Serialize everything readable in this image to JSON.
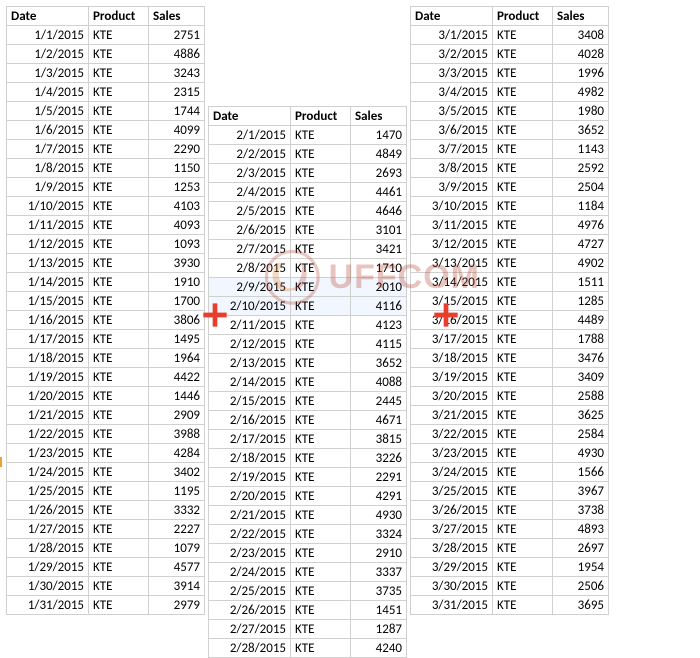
{
  "headers": {
    "date": "Date",
    "product": "Product",
    "sales": "Sales"
  },
  "chart_data": {
    "type": "table",
    "tables": [
      {
        "columns": [
          "Date",
          "Product",
          "Sales"
        ],
        "rows": [
          [
            "1/1/2015",
            "KTE",
            2751
          ],
          [
            "1/2/2015",
            "KTE",
            4886
          ],
          [
            "1/3/2015",
            "KTE",
            3243
          ],
          [
            "1/4/2015",
            "KTE",
            2315
          ],
          [
            "1/5/2015",
            "KTE",
            1744
          ],
          [
            "1/6/2015",
            "KTE",
            4099
          ],
          [
            "1/7/2015",
            "KTE",
            2290
          ],
          [
            "1/8/2015",
            "KTE",
            1150
          ],
          [
            "1/9/2015",
            "KTE",
            1253
          ],
          [
            "1/10/2015",
            "KTE",
            4103
          ],
          [
            "1/11/2015",
            "KTE",
            4093
          ],
          [
            "1/12/2015",
            "KTE",
            1093
          ],
          [
            "1/13/2015",
            "KTE",
            3930
          ],
          [
            "1/14/2015",
            "KTE",
            1910
          ],
          [
            "1/15/2015",
            "KTE",
            1700
          ],
          [
            "1/16/2015",
            "KTE",
            3806
          ],
          [
            "1/17/2015",
            "KTE",
            1495
          ],
          [
            "1/18/2015",
            "KTE",
            1964
          ],
          [
            "1/19/2015",
            "KTE",
            4422
          ],
          [
            "1/20/2015",
            "KTE",
            1446
          ],
          [
            "1/21/2015",
            "KTE",
            2909
          ],
          [
            "1/22/2015",
            "KTE",
            3988
          ],
          [
            "1/23/2015",
            "KTE",
            4284
          ],
          [
            "1/24/2015",
            "KTE",
            3402
          ],
          [
            "1/25/2015",
            "KTE",
            1195
          ],
          [
            "1/26/2015",
            "KTE",
            3332
          ],
          [
            "1/27/2015",
            "KTE",
            2227
          ],
          [
            "1/28/2015",
            "KTE",
            1079
          ],
          [
            "1/29/2015",
            "KTE",
            4577
          ],
          [
            "1/30/2015",
            "KTE",
            3914
          ],
          [
            "1/31/2015",
            "KTE",
            2979
          ]
        ]
      },
      {
        "columns": [
          "Date",
          "Product",
          "Sales"
        ],
        "rows": [
          [
            "2/1/2015",
            "KTE",
            1470
          ],
          [
            "2/2/2015",
            "KTE",
            4849
          ],
          [
            "2/3/2015",
            "KTE",
            2693
          ],
          [
            "2/4/2015",
            "KTE",
            4461
          ],
          [
            "2/5/2015",
            "KTE",
            4646
          ],
          [
            "2/6/2015",
            "KTE",
            3101
          ],
          [
            "2/7/2015",
            "KTE",
            3421
          ],
          [
            "2/8/2015",
            "KTE",
            1710
          ],
          [
            "2/9/2015",
            "KTE",
            2010
          ],
          [
            "2/10/2015",
            "KTE",
            4116
          ],
          [
            "2/11/2015",
            "KTE",
            4123
          ],
          [
            "2/12/2015",
            "KTE",
            4115
          ],
          [
            "2/13/2015",
            "KTE",
            3652
          ],
          [
            "2/14/2015",
            "KTE",
            4088
          ],
          [
            "2/15/2015",
            "KTE",
            2445
          ],
          [
            "2/16/2015",
            "KTE",
            4671
          ],
          [
            "2/17/2015",
            "KTE",
            3815
          ],
          [
            "2/18/2015",
            "KTE",
            3226
          ],
          [
            "2/19/2015",
            "KTE",
            2291
          ],
          [
            "2/20/2015",
            "KTE",
            4291
          ],
          [
            "2/21/2015",
            "KTE",
            4930
          ],
          [
            "2/22/2015",
            "KTE",
            3324
          ],
          [
            "2/23/2015",
            "KTE",
            2910
          ],
          [
            "2/24/2015",
            "KTE",
            3337
          ],
          [
            "2/25/2015",
            "KTE",
            3735
          ],
          [
            "2/26/2015",
            "KTE",
            1451
          ],
          [
            "2/27/2015",
            "KTE",
            1287
          ],
          [
            "2/28/2015",
            "KTE",
            4240
          ]
        ]
      },
      {
        "columns": [
          "Date",
          "Product",
          "Sales"
        ],
        "rows": [
          [
            "3/1/2015",
            "KTE",
            3408
          ],
          [
            "3/2/2015",
            "KTE",
            4028
          ],
          [
            "3/3/2015",
            "KTE",
            1996
          ],
          [
            "3/4/2015",
            "KTE",
            4982
          ],
          [
            "3/5/2015",
            "KTE",
            1980
          ],
          [
            "3/6/2015",
            "KTE",
            3652
          ],
          [
            "3/7/2015",
            "KTE",
            1143
          ],
          [
            "3/8/2015",
            "KTE",
            2592
          ],
          [
            "3/9/2015",
            "KTE",
            2504
          ],
          [
            "3/10/2015",
            "KTE",
            1184
          ],
          [
            "3/11/2015",
            "KTE",
            4976
          ],
          [
            "3/12/2015",
            "KTE",
            4727
          ],
          [
            "3/13/2015",
            "KTE",
            4902
          ],
          [
            "3/14/2015",
            "KTE",
            1511
          ],
          [
            "3/15/2015",
            "KTE",
            1285
          ],
          [
            "3/16/2015",
            "KTE",
            4489
          ],
          [
            "3/17/2015",
            "KTE",
            1788
          ],
          [
            "3/18/2015",
            "KTE",
            3476
          ],
          [
            "3/19/2015",
            "KTE",
            3409
          ],
          [
            "3/20/2015",
            "KTE",
            2588
          ],
          [
            "3/21/2015",
            "KTE",
            3625
          ],
          [
            "3/22/2015",
            "KTE",
            2584
          ],
          [
            "3/23/2015",
            "KTE",
            4930
          ],
          [
            "3/24/2015",
            "KTE",
            1566
          ],
          [
            "3/25/2015",
            "KTE",
            3967
          ],
          [
            "3/26/2015",
            "KTE",
            3738
          ],
          [
            "3/27/2015",
            "KTE",
            4893
          ],
          [
            "3/28/2015",
            "KTE",
            2697
          ],
          [
            "3/29/2015",
            "KTE",
            1954
          ],
          [
            "3/30/2015",
            "KTE",
            2506
          ],
          [
            "3/31/2015",
            "KTE",
            3695
          ]
        ]
      }
    ]
  },
  "watermark_text": "UFFCOM",
  "plus_color": "#e83e2e",
  "watermark_color": "rgba(184,74,52,0.55)"
}
